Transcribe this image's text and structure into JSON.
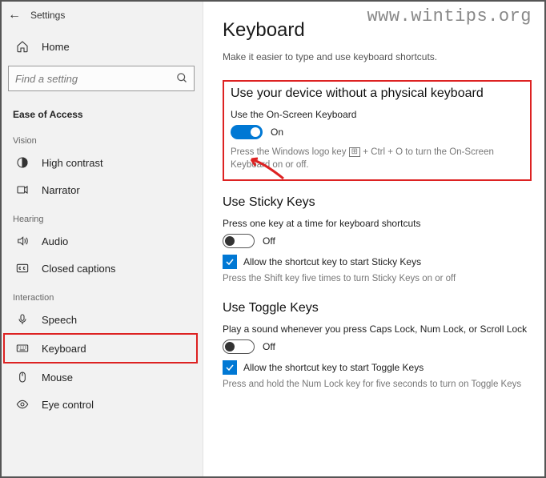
{
  "watermark": "www.wintips.org",
  "titlebar": {
    "title": "Settings"
  },
  "sidebar": {
    "home_label": "Home",
    "search_placeholder": "Find a setting",
    "section": "Ease of Access",
    "groups": {
      "vision": {
        "label": "Vision",
        "items": [
          "High contrast",
          "Narrator"
        ]
      },
      "hearing": {
        "label": "Hearing",
        "items": [
          "Audio",
          "Closed captions"
        ]
      },
      "interaction": {
        "label": "Interaction",
        "items": [
          "Speech",
          "Keyboard",
          "Mouse",
          "Eye control"
        ]
      }
    }
  },
  "main": {
    "heading": "Keyboard",
    "sub": "Make it easier to type and use keyboard shortcuts.",
    "osk": {
      "heading": "Use your device without a physical keyboard",
      "label": "Use the On-Screen Keyboard",
      "state": "On",
      "hint_pre": "Press the Windows logo key ",
      "hint_post": " + Ctrl + O to turn the On-Screen Keyboard on or off."
    },
    "sticky": {
      "heading": "Use Sticky Keys",
      "label": "Press one key at a time for keyboard shortcuts",
      "state": "Off",
      "check_label": "Allow the shortcut key to start Sticky Keys",
      "hint": "Press the Shift key five times to turn Sticky Keys on or off"
    },
    "toggle_keys": {
      "heading": "Use Toggle Keys",
      "label": "Play a sound whenever you press Caps Lock, Num Lock, or Scroll Lock",
      "state": "Off",
      "check_label": "Allow the shortcut key to start Toggle Keys",
      "hint": "Press and hold the Num Lock key for five seconds to turn on Toggle Keys"
    }
  }
}
